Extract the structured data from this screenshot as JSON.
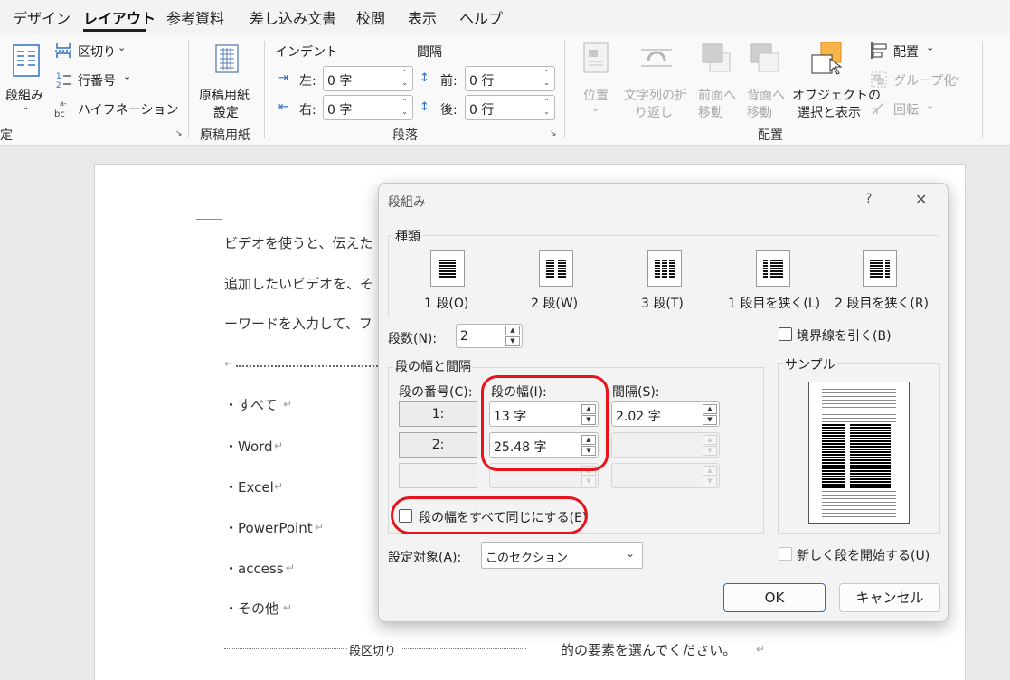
{
  "tabs": [
    "デザイン",
    "レイアウト",
    "参考資料",
    "差し込み文書",
    "校閲",
    "表示",
    "ヘルプ"
  ],
  "ribbon": {
    "columns_label": "段組み",
    "breaks_label": "区切り",
    "line_numbers_label": "行番号",
    "hyphenation_label": "ハイフネーション",
    "page_setup_group": "定",
    "genko_label1": "原稿用紙",
    "genko_label2": "設定",
    "genko_group": "原稿用紙",
    "indent_title": "インデント",
    "spacing_title": "間隔",
    "left_label": "左:",
    "left_value": "0 字",
    "right_label": "右:",
    "right_value": "0 字",
    "before_label": "前:",
    "before_value": "0 行",
    "after_label": "後:",
    "after_value": "0 行",
    "paragraph_group": "段落",
    "position_label": "位置",
    "wrap_label1": "文字列の折",
    "wrap_label2": "り返し",
    "forward_label1": "前面へ",
    "forward_label2": "移動",
    "backward_label1": "背面へ",
    "backward_label2": "移動",
    "pane_label1": "オブジェクトの",
    "pane_label2": "選択と表示",
    "align_label": "配置",
    "group_label": "グループ化",
    "rotate_label": "回転",
    "arrange_group": "配置"
  },
  "doc": {
    "line1": "ビデオを使うと、伝えた",
    "line2": "追加したいビデオを、そ",
    "line3": "ーワードを入力して、フ",
    "items": [
      "・すべて",
      "・Word",
      "・Excel",
      "・PowerPoint",
      "・access",
      "・その他"
    ],
    "section_break": "段区切り",
    "last_line": "的の要素を選んでください。"
  },
  "dialog": {
    "title": "段組み",
    "help": "?",
    "close": "✕",
    "presets_label": "種類",
    "presets": [
      "1 段(O)",
      "2 段(W)",
      "3 段(T)",
      "1 段目を狭く(L)",
      "2 段目を狭く(R)"
    ],
    "num_label": "段数(N):",
    "num_value": "2",
    "line_between_label": "境界線を引く(B)",
    "width_spacing_label": "段の幅と間隔",
    "col_num_header": "段の番号(C):",
    "width_header": "段の幅(I):",
    "spacing_header": "間隔(S):",
    "rows": [
      {
        "num": "1:",
        "width": "13 字",
        "spacing": "2.02 字"
      },
      {
        "num": "2:",
        "width": "25.48 字",
        "spacing": ""
      },
      {
        "num": "",
        "width": "",
        "spacing": ""
      }
    ],
    "equal_width_label": "段の幅をすべて同じにする(E)",
    "preview_label": "サンプル",
    "apply_label": "設定対象(A):",
    "apply_value": "このセクション",
    "new_column_label": "新しく段を開始する(U)",
    "ok": "OK",
    "cancel": "キャンセル"
  }
}
